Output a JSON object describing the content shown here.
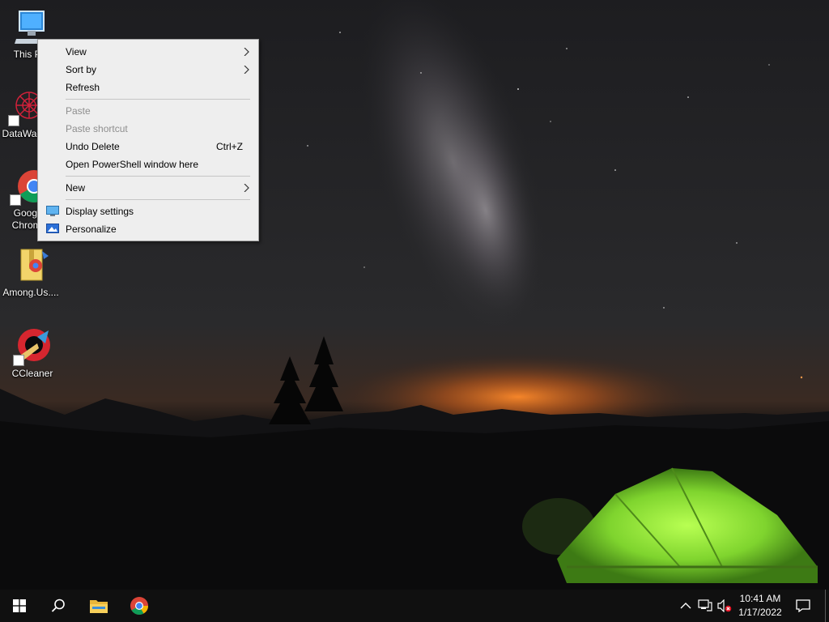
{
  "desktop": {
    "icons": [
      {
        "name": "this-pc",
        "label": "This PC"
      },
      {
        "name": "datawagon",
        "label": "DataWagon"
      },
      {
        "name": "google-chrome",
        "label": "Google Chrome"
      },
      {
        "name": "among-us",
        "label": "Among.Us...."
      },
      {
        "name": "ccleaner",
        "label": "CCleaner"
      }
    ]
  },
  "context_menu": {
    "view": "View",
    "sort_by": "Sort by",
    "refresh": "Refresh",
    "paste": "Paste",
    "paste_shortcut": "Paste shortcut",
    "undo_delete": "Undo Delete",
    "undo_delete_shortcut": "Ctrl+Z",
    "open_powershell": "Open PowerShell window here",
    "new": "New",
    "display_settings": "Display settings",
    "personalize": "Personalize"
  },
  "taskbar": {
    "start": "windows-logo-icon",
    "search": "search-icon",
    "pinned": [
      "file-explorer-icon",
      "chrome-icon"
    ],
    "tray": [
      "chevron-up-icon",
      "network-icon",
      "volume-muted-icon"
    ],
    "clock_time": "10:41 AM",
    "clock_date": "1/17/2022",
    "notification": "action-center-icon"
  },
  "colors": {
    "menu_bg": "#eeeeee",
    "taskbar_bg": "#101010",
    "tent_green": "#8ee83a",
    "horizon_orange": "#ff7a1a"
  }
}
